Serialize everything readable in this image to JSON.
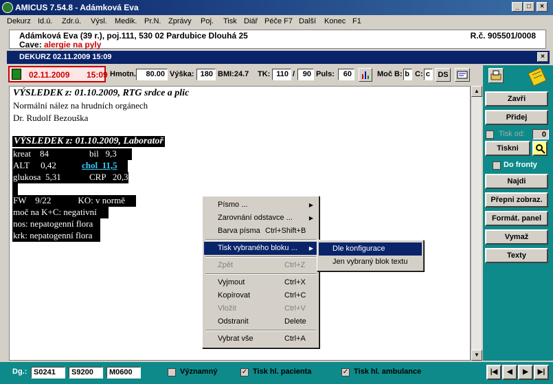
{
  "window": {
    "title": "AMICUS  7.54.8  -  Adámková Eva"
  },
  "menu": [
    "Dekurz",
    "Id.ú.",
    "Zdr.ú.",
    "Výsl.",
    "Medik.",
    "Pr.N.",
    "Zprávy",
    "Poj.",
    "Tisk",
    "Diář",
    "Péče F7",
    "Další",
    "Konec",
    "F1"
  ],
  "patient": {
    "line1": "Adámková Eva (39 r.), poj.111,   530 02 Pardubice  Dlouhá 25",
    "cave_label": "Cave:",
    "cave_value": "alergie na pyly",
    "rc": "R.č. 905501/0008"
  },
  "dekurz": {
    "title": "DEKURZ 02.11.2009 15:09"
  },
  "toolbar": {
    "date": "02.11.2009",
    "time": "15:09",
    "hmotn_label": "Hmotn.:",
    "hmotn": "80.00",
    "vyska_label": "Výška:",
    "vyska": "180",
    "bmi": "BMI:24.7",
    "tk_label": "TK:",
    "tk1": "110",
    "tk_sep": "/",
    "tk2": "90",
    "puls_label": "Puls:",
    "puls": "60",
    "moc_label": "Moč B:",
    "moc_b": "b",
    "moc_c_label": "C:",
    "moc_c": "c",
    "ds": "DS"
  },
  "editor": {
    "h1": "VÝSLEDEK z: 01.10.2009, RTG srdce a plic",
    "l1": "Normální  nález na hrudních orgánech",
    "l2": "Dr.  Rudolf Bezouška",
    "h2": "VÝSLEDEK z: 01.10.2009, Laboratoř",
    "lab": [
      [
        "kreat    84",
        "bil   9,3"
      ],
      [
        "ALT     0,42",
        "chol  11,5"
      ],
      [
        "glukosa  5,31",
        "CRP   20,3"
      ]
    ],
    "fw": "FW    9/22            KO: v normě",
    "moc": "moč na K+C: negativní",
    "nos": "nos: nepatogenní flora",
    "krk": "krk: nepatogenní flora"
  },
  "sidebar": {
    "zavri": "Zavři",
    "pridej": "Přidej",
    "tisk_od": "Tisk od:",
    "tisk_od_val": "0",
    "tiskni": "Tiskni",
    "do_fronty": "Do fronty",
    "najdi": "Najdi",
    "prepni": "Přepni zobraz.",
    "format": "Formát. panel",
    "vymaz": "Vymaž",
    "texty": "Texty"
  },
  "context_menu": {
    "items": [
      {
        "label": "Písmo ...",
        "key": "",
        "sub": true
      },
      {
        "label": "Zarovnání odstavce ...",
        "key": "",
        "sub": true
      },
      {
        "label": "Barva písma",
        "key": "Ctrl+Shift+B",
        "sub": false
      },
      {
        "label": "Tisk vybraného bloku ...",
        "key": "",
        "sub": true
      },
      {
        "label": "Zpět",
        "key": "Ctrl+Z",
        "sub": false
      },
      {
        "label": "Vyjmout",
        "key": "Ctrl+X",
        "sub": false
      },
      {
        "label": "Kopírovat",
        "key": "Ctrl+C",
        "sub": false
      },
      {
        "label": "Vložit",
        "key": "Ctrl+V",
        "sub": false
      },
      {
        "label": "Odstranit",
        "key": "Delete",
        "sub": false
      },
      {
        "label": "Vybrat vše",
        "key": "Ctrl+A",
        "sub": false
      }
    ],
    "submenu": [
      "Dle konfigurace",
      "Jen vybraný blok textu"
    ]
  },
  "bottom": {
    "dg_label": "Dg.:",
    "dg": [
      "S0241",
      "S9200",
      "M0600"
    ],
    "vyznamny": "Významný",
    "tisk_pacienta": "Tisk hl. pacienta",
    "tisk_ambulance": "Tisk hl. ambulance"
  },
  "colors": {
    "titlebar": "#0a246a",
    "panel": "#0e8a8a",
    "date_red": "#cc0000"
  }
}
